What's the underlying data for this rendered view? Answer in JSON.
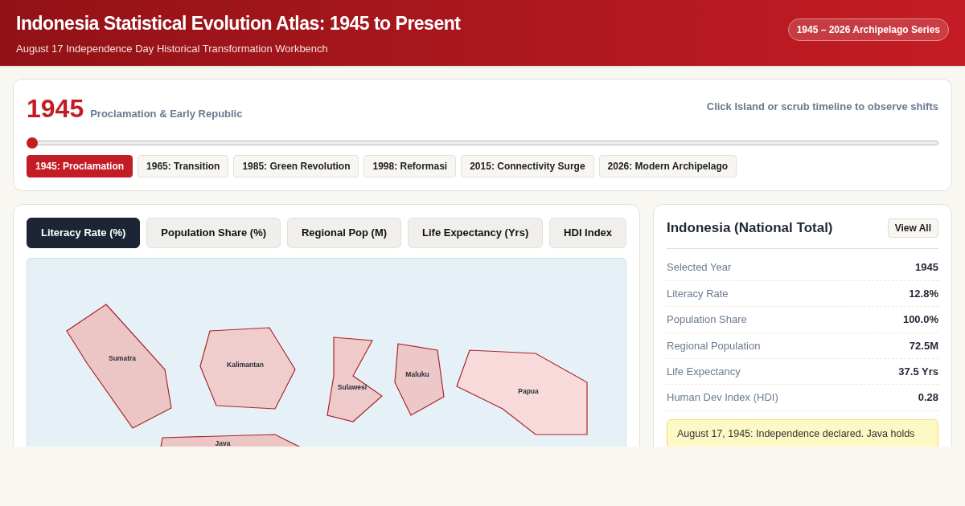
{
  "header": {
    "title": "Indonesia Statistical Evolution Atlas: 1945 to Present",
    "subtitle": "August 17 Independence Day Historical Transformation Workbench",
    "badge": "1945 – 2026 Archipelago Series"
  },
  "timeline": {
    "year": "1945",
    "era": "Proclamation & Early Republic",
    "hint": "Click Island or scrub timeline to observe shifts",
    "level": 0,
    "milestones": [
      {
        "label": "1945: Proclamation",
        "selected": true
      },
      {
        "label": "1965: Transition",
        "selected": false
      },
      {
        "label": "1985: Green Revolution",
        "selected": false
      },
      {
        "label": "1998: Reformasi",
        "selected": false
      },
      {
        "label": "2015: Connectivity Surge",
        "selected": false
      },
      {
        "label": "2026: Modern Archipelago",
        "selected": false
      }
    ]
  },
  "metric_tabs": [
    {
      "label": "Literacy Rate (%)",
      "selected": true
    },
    {
      "label": "Population Share (%)",
      "selected": false
    },
    {
      "label": "Regional Pop (M)",
      "selected": false
    },
    {
      "label": "Life Expectancy (Yrs)",
      "selected": false
    },
    {
      "label": "HDI Index",
      "selected": false
    }
  ],
  "islands": [
    {
      "name": "Sumatra",
      "color": "#ecc5c5"
    },
    {
      "name": "Kalimantan",
      "color": "#f0cdcd"
    },
    {
      "name": "Sulawesi",
      "color": "#efcaca"
    },
    {
      "name": "Maluku",
      "color": "#edc8c8"
    },
    {
      "name": "Papua",
      "color": "#f8dadb"
    },
    {
      "name": "Java",
      "color": "#ecc5c5"
    }
  ],
  "detail": {
    "title": "Indonesia (National Total)",
    "button": "View All",
    "rows": [
      {
        "label": "Selected Year",
        "value": "1945"
      },
      {
        "label": "Literacy Rate",
        "value": "12.8%"
      },
      {
        "label": "Population Share",
        "value": "100.0%"
      },
      {
        "label": "Regional Population",
        "value": "72.5M"
      },
      {
        "label": "Life Expectancy",
        "value": "37.5 Yrs"
      },
      {
        "label": "Human Dev Index (HDI)",
        "value": "0.28"
      }
    ],
    "note": "August 17, 1945: Independence declared. Java holds"
  }
}
